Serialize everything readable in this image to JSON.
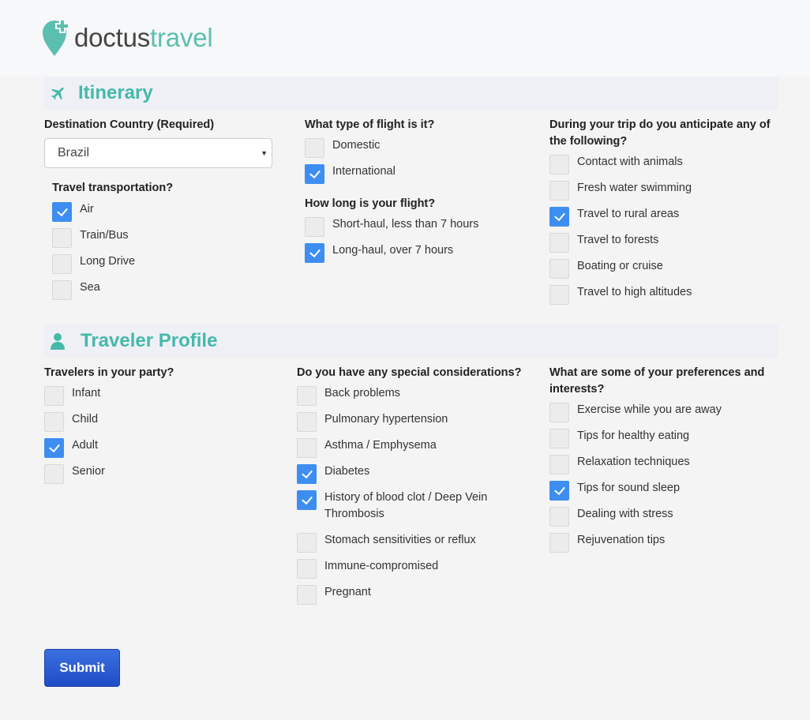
{
  "brand": {
    "part1": "doctus",
    "part2": "travel",
    "accent": "#5bbfb0"
  },
  "itinerary": {
    "title": "Itinerary",
    "icon": "airplane-icon",
    "destination": {
      "label": "Destination Country (Required)",
      "value": "Brazil"
    },
    "transport": {
      "label": "Travel transportation?",
      "options": [
        {
          "label": "Air",
          "checked": true
        },
        {
          "label": "Train/Bus",
          "checked": false
        },
        {
          "label": "Long Drive",
          "checked": false
        },
        {
          "label": "Sea",
          "checked": false
        }
      ]
    },
    "flight_type": {
      "label": "What type of flight is it?",
      "options": [
        {
          "label": "Domestic",
          "checked": false
        },
        {
          "label": "International",
          "checked": true
        }
      ]
    },
    "flight_length": {
      "label": "How long is your flight?",
      "options": [
        {
          "label": "Short-haul, less than 7 hours",
          "checked": false
        },
        {
          "label": "Long-haul, over 7 hours",
          "checked": true
        }
      ]
    },
    "anticipate": {
      "label": "During your trip do you anticipate any of the following?",
      "options": [
        {
          "label": "Contact with animals",
          "checked": false
        },
        {
          "label": "Fresh water swimming",
          "checked": false
        },
        {
          "label": "Travel to rural areas",
          "checked": true
        },
        {
          "label": "Travel to forests",
          "checked": false
        },
        {
          "label": "Boating or cruise",
          "checked": false
        },
        {
          "label": "Travel to high altitudes",
          "checked": false
        }
      ]
    }
  },
  "profile": {
    "title": "Traveler Profile",
    "icon": "user-icon",
    "travelers": {
      "label": "Travelers in your party?",
      "options": [
        {
          "label": "Infant",
          "checked": false
        },
        {
          "label": "Child",
          "checked": false
        },
        {
          "label": "Adult",
          "checked": true
        },
        {
          "label": "Senior",
          "checked": false
        }
      ]
    },
    "considerations": {
      "label": "Do you have any special considerations?",
      "options": [
        {
          "label": "Back problems",
          "checked": false
        },
        {
          "label": "Pulmonary hypertension",
          "checked": false
        },
        {
          "label": "Asthma / Emphysema",
          "checked": false
        },
        {
          "label": "Diabetes",
          "checked": true
        },
        {
          "label": "History of blood clot / Deep Vein Thrombosis",
          "checked": true
        },
        {
          "label": "Stomach sensitivities or reflux",
          "checked": false
        },
        {
          "label": "Immune-compromised",
          "checked": false
        },
        {
          "label": "Pregnant",
          "checked": false
        }
      ]
    },
    "preferences": {
      "label": "What are some of your preferences and interests?",
      "options": [
        {
          "label": "Exercise while you are away",
          "checked": false
        },
        {
          "label": "Tips for healthy eating",
          "checked": false
        },
        {
          "label": "Relaxation techniques",
          "checked": false
        },
        {
          "label": "Tips for sound sleep",
          "checked": true
        },
        {
          "label": "Dealing with stress",
          "checked": false
        },
        {
          "label": "Rejuvenation tips",
          "checked": false
        }
      ]
    }
  },
  "submit_label": "Submit",
  "colors": {
    "heading": "#45b9aa",
    "checkbox_checked": "#3d8ef0",
    "submit": "#2a59d2"
  }
}
